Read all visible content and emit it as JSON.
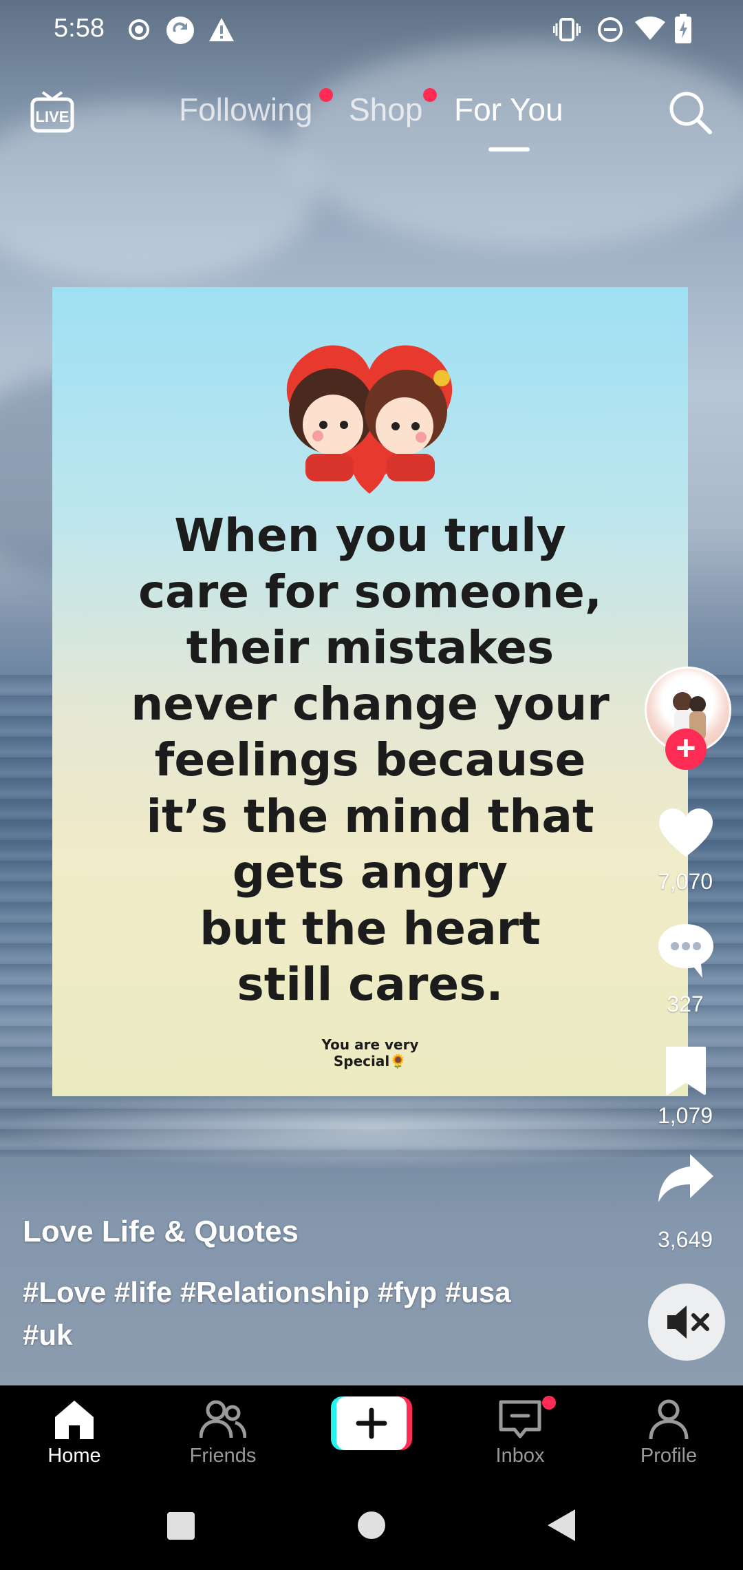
{
  "status_bar": {
    "time": "5:58",
    "icons_left": [
      "record-icon",
      "sync-icon",
      "warning-icon"
    ],
    "icons_right": [
      "vibrate-icon",
      "do-not-disturb-icon",
      "wifi-icon",
      "battery-icon"
    ]
  },
  "top_nav": {
    "live_label": "LIVE",
    "tabs": [
      {
        "label": "Following",
        "has_dot": true
      },
      {
        "label": "Shop",
        "has_dot": true
      },
      {
        "label": "For You",
        "active": true
      }
    ]
  },
  "post": {
    "image_text": "When you truly\ncare for someone,\ntheir mistakes\nnever change your\nfeelings because\nit’s the mind that\ngets angry\nbut the heart\nstill cares.",
    "image_footer": "You are very\nSpecial🌻",
    "author": "Love Life & Quotes",
    "caption": "#Love #life #Relationship #fyp #usa #uk"
  },
  "actions": {
    "likes": "7,070",
    "comments": "327",
    "saves": "1,079",
    "shares": "3,649"
  },
  "bottom_nav": [
    {
      "label": "Home",
      "active": true
    },
    {
      "label": "Friends"
    },
    {
      "label": ""
    },
    {
      "label": "Inbox",
      "has_dot": true
    },
    {
      "label": "Profile"
    }
  ],
  "colors": {
    "accent": "#fe2c55",
    "create_cyan": "#25f4ee"
  }
}
